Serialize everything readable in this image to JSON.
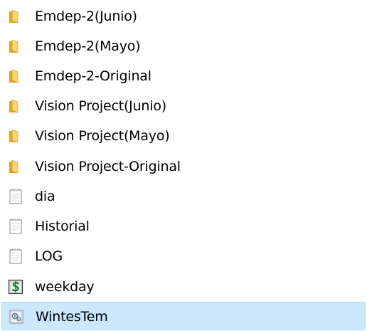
{
  "items": [
    {
      "name": "Emdep-2(Junio)",
      "icon": "folder-icon"
    },
    {
      "name": "Emdep-2(Mayo)",
      "icon": "folder-icon"
    },
    {
      "name": "Emdep-2-Original",
      "icon": "folder-icon"
    },
    {
      "name": "Vision Project(Junio)",
      "icon": "folder-icon"
    },
    {
      "name": "Vision Project(Mayo)",
      "icon": "folder-icon"
    },
    {
      "name": "Vision Project-Original",
      "icon": "folder-icon"
    },
    {
      "name": "dia",
      "icon": "text-file-icon"
    },
    {
      "name": "Historial",
      "icon": "text-file-icon"
    },
    {
      "name": "LOG",
      "icon": "text-file-icon"
    },
    {
      "name": "weekday",
      "icon": "dollar-script-icon"
    },
    {
      "name": "WintesTem",
      "icon": "config-file-icon",
      "selected": true
    }
  ],
  "colors": {
    "selection_background": "#cce8ff",
    "selection_border": "#b5dbfb",
    "folder": "#e8b13a"
  }
}
